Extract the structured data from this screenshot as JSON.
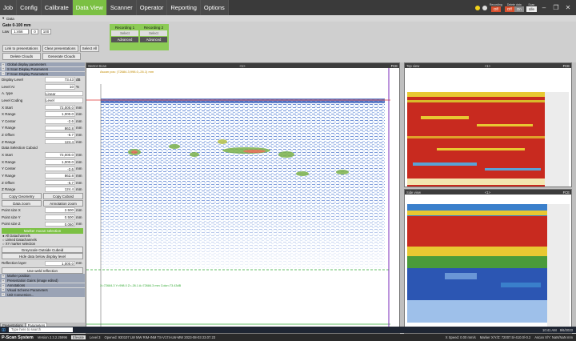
{
  "tabs": [
    "Job",
    "Config",
    "Calibrate",
    "Data View",
    "Scanner",
    "Operator",
    "Reporting",
    "Options"
  ],
  "recording_status": {
    "label": "Recording",
    "value": "Off"
  },
  "delete_data": {
    "label": "Delete data",
    "btn": "Off",
    "btn2": "On"
  },
  "scan": {
    "label": "Scan",
    "value": "Idle"
  },
  "subbar": {
    "label": "Data"
  },
  "gate": {
    "title": "Gate 0-100 mm",
    "law_label": "Law",
    "law_value": "1:466",
    "law_v2": "0",
    "law_v3": "100"
  },
  "buttons": {
    "link": "Link to presentations",
    "clear": "Clear presentations",
    "select_all": "Select All",
    "delete_clouds": "Delete Clouds",
    "generate_clouds": "Generate Clouds"
  },
  "recordings": [
    {
      "title": "Recording 1",
      "select": "Select",
      "advanced": "Advanced"
    },
    {
      "title": "Recording 2",
      "select": "Select",
      "advanced": "Advanced"
    }
  ],
  "sections_top": [
    "Global display parameters",
    "S Scan Display Parameters",
    "P Scan Display Parameters"
  ],
  "params": [
    {
      "label": "Display Level",
      "value": "73.43",
      "unit": "dB"
    },
    {
      "label": "Level At",
      "value": "10",
      "unit": "%"
    },
    {
      "label": "A. type",
      "value": "Linear",
      "unit": ""
    },
    {
      "label": "Level Coding",
      "value": "Level",
      "unit": ""
    },
    {
      "label": "X Start",
      "value": "72,000.0",
      "unit": "mm"
    },
    {
      "label": "X Range",
      "value": "1,000.0",
      "unit": "mm"
    },
    {
      "label": "Y Center",
      "value": "-2.6",
      "unit": "mm"
    },
    {
      "label": "Y Range",
      "value": "863.8",
      "unit": "mm"
    },
    {
      "label": "Z Offset",
      "value": "-6.7",
      "unit": "mm"
    },
    {
      "label": "Z Range",
      "value": "124.4",
      "unit": "mm"
    }
  ],
  "cuboid": {
    "title": "Data Selection Cuboid",
    "rows": [
      {
        "label": "X Start",
        "value": "72,000.0",
        "unit": "mm"
      },
      {
        "label": "X Range",
        "value": "1,000.0",
        "unit": "mm"
      },
      {
        "label": "Y Center",
        "value": "-2.6",
        "unit": "mm"
      },
      {
        "label": "Y Range",
        "value": "863.8",
        "unit": "mm"
      },
      {
        "label": "Z Offset",
        "value": "-6.7",
        "unit": "mm"
      },
      {
        "label": "Z Range",
        "value": "124.4",
        "unit": "mm"
      }
    ]
  },
  "geom_buttons": [
    "Copy Geometry",
    "Copy Cuboid",
    "Data zoom",
    "Annotation zoom"
  ],
  "points": [
    {
      "label": "Point size X",
      "value": "2.500",
      "unit": "mm"
    },
    {
      "label": "Point size Y",
      "value": "0.500",
      "unit": "mm"
    },
    {
      "label": "Point size Z",
      "value": "0.060",
      "unit": "mm"
    }
  ],
  "marker_btn": "Marker Ascan selection",
  "marker_opts": [
    "All Datachannels",
    "Linked Datachannels",
    "XY marker selection"
  ],
  "greyscale_btn": "Greyscale Outside Cubeid",
  "hide_btn": "Hide data below display level",
  "reflection": {
    "label": "Reflection layer",
    "value": "1,000.0",
    "unit": "mm"
  },
  "weld_btn": "Use weld reflection",
  "sections_bottom": [
    "Marker position",
    "Presentation Gains (image edited)",
    "Annotations",
    "Visual Scheme Parameters",
    "Unit Conversion..."
  ],
  "bottom_tabs": [
    "Presentations",
    "Parameters"
  ],
  "panes": {
    "sector": {
      "title": "Sector-Scan",
      "center": "<1>",
      "right": "FCE"
    },
    "top": {
      "title": "Top view",
      "center": "<1>",
      "right": "FCE"
    },
    "side": {
      "title": "Side view",
      "center": "<1>",
      "right": "FCE"
    }
  },
  "sector_annot": "Ascan pos: (72684.3,998.0,-26.1) mm",
  "sector_bottom_annot": "X=72684.3 Y=998.0 Z=-26.1 A=72684.3 mm  Color=73.43dB",
  "status": {
    "logo": "P-Scan System",
    "version": "Version 2.3.2.25996",
    "level_btn": "Elevate",
    "level": "Level 3",
    "opened": "Opened: 930107 LW MW RIM-INM TS-V174-LW-MW 2023-08-03 23.07.23",
    "speed": "X Speed: 0.00 mm/s",
    "marker": "Marker X/Y/Z: 72007.5/-410.0/-0.2",
    "ascan": "Ascan X/Y: NaN/NaN mm"
  },
  "taskbar": {
    "search": "Type here to search",
    "time": "10:41 AM",
    "date": "9/6/2023"
  },
  "colors": {
    "accent": "#7bc043",
    "record": "#d9502e",
    "section": "#9aa3b5"
  }
}
